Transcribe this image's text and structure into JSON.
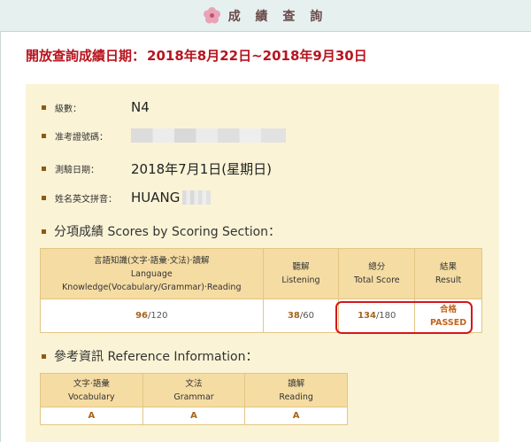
{
  "header": {
    "title": "成 績 查 詢"
  },
  "period": {
    "label": "開放查詢成績日期：",
    "value": "2018年8月22日~2018年9月30日"
  },
  "info": {
    "level_label": "級數：",
    "level_value": "N4",
    "ticket_label": "准考證號碼：",
    "date_label": "測驗日期：",
    "date_value": "2018年7月1日(星期日)",
    "name_label": "姓名英文拼音：",
    "name_value": "HUANG"
  },
  "scores": {
    "title": "分項成績 Scores by Scoring Section：",
    "headers": {
      "language_zh": "言語知識(文字‧語彙‧文法)‧讀解",
      "language_en1": "Language",
      "language_en2": "Knowledge(Vocabulary/Grammar)‧Reading",
      "listening_zh": "聽解",
      "listening_en": "Listening",
      "total_zh": "總分",
      "total_en": "Total Score",
      "result_zh": "結果",
      "result_en": "Result"
    },
    "values": {
      "language_score": "96",
      "language_max": "/120",
      "listening_score": "38",
      "listening_max": "/60",
      "total_score": "134",
      "total_max": "/180",
      "result_zh": "合格",
      "result_en": "PASSED"
    }
  },
  "reference": {
    "title": "參考資訊 Reference Information：",
    "headers": {
      "vocab_zh": "文字‧語彙",
      "vocab_en": "Vocabulary",
      "grammar_zh": "文法",
      "grammar_en": "Grammar",
      "reading_zh": "讀解",
      "reading_en": "Reading"
    },
    "values": {
      "vocab": "A",
      "grammar": "A",
      "reading": "A"
    }
  },
  "colors": {
    "accent_red": "#b8141e",
    "panel_bg": "#faf3d6",
    "table_header_bg": "#f5dca3",
    "score_color": "#a5651a",
    "highlight_border": "#d5161d"
  }
}
